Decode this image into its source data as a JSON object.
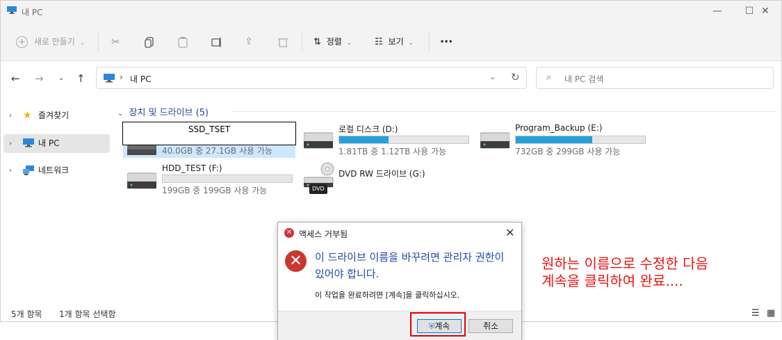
{
  "window": {
    "title": "내 PC",
    "controls": {
      "minimize": "—",
      "maximize": "☐",
      "close": "✕"
    }
  },
  "toolbar": {
    "new_label": "새로 만들기",
    "sort_label": "정렬",
    "view_label": "보기",
    "more_label": "···"
  },
  "address": {
    "location": "내 PC",
    "separator": "›"
  },
  "search": {
    "placeholder": "내 PC 검색"
  },
  "sidebar": {
    "items": [
      {
        "label": "즐겨찾기",
        "icon": "star-icon"
      },
      {
        "label": "내 PC",
        "icon": "pc-icon"
      },
      {
        "label": "네트워크",
        "icon": "network-icon"
      }
    ]
  },
  "content": {
    "group_title": "장치 및 드라이브 (5)",
    "drives": [
      {
        "name": "SSD_TSET",
        "info": "40.0GB 중 27.1GB 사용 가능",
        "used_fraction": 0.32,
        "renaming": true
      },
      {
        "name": "로컬 디스크 (D:)",
        "info": "1.81TB 중 1.12TB 사용 가능",
        "used_fraction": 0.38
      },
      {
        "name": "Program_Backup (E:)",
        "info": "732GB 중 299GB 사용 가능",
        "used_fraction": 0.59
      },
      {
        "name": "HDD_TEST (F:)",
        "info": "199GB 중 199GB 사용 가능",
        "used_fraction": 0.0
      },
      {
        "name": "DVD RW 드라이브 (G:)",
        "badge": "DVD"
      }
    ]
  },
  "status": {
    "count": "5개 항목",
    "selected": "1개 항목 선택함"
  },
  "dialog": {
    "title": "액세스 거부됨",
    "close": "✕",
    "message": "이 드라이브 이름을 바꾸려면 관리자 권한이 있어야 합니다.",
    "sub": "이 작업을 완료하려면 [계속]을 클릭하십시오.",
    "continue_label": "계속",
    "cancel_label": "취소"
  },
  "annotation": {
    "line1": "원하는 이름으로 수정한 다음",
    "line2": "계속을 클릭하여 완료....",
    "color": "#ee1111"
  },
  "colors": {
    "accent": "#26a0da",
    "selection": "#cce8ff",
    "link": "#1f4aa8"
  }
}
